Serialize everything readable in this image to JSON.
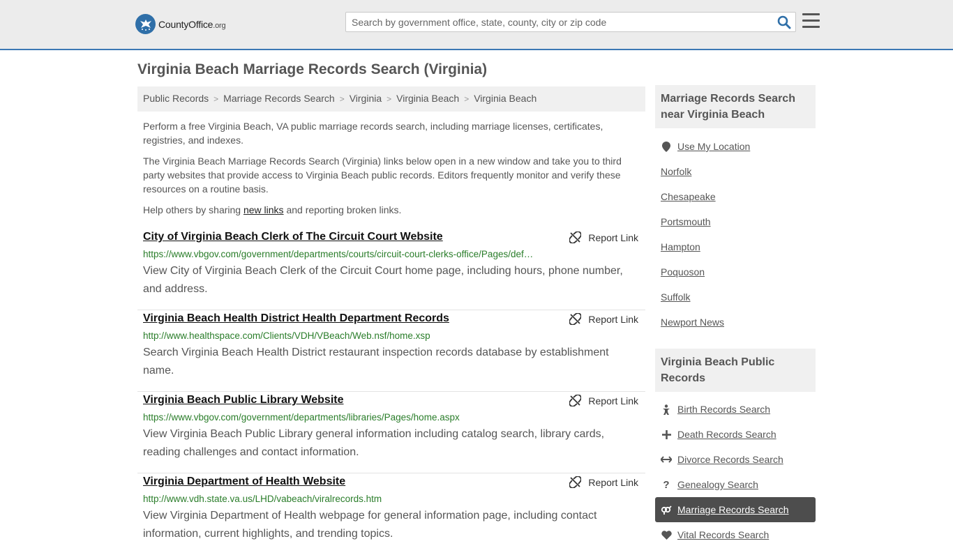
{
  "header": {
    "logo_main": "CountyOffice",
    "logo_suffix": ".org",
    "search_placeholder": "Search by government office, state, county, city or zip code"
  },
  "page_title": "Virginia Beach Marriage Records Search (Virginia)",
  "breadcrumb": [
    "Public Records",
    "Marriage Records Search",
    "Virginia",
    "Virginia Beach",
    "Virginia Beach"
  ],
  "intro": {
    "p1": "Perform a free Virginia Beach, VA public marriage records search, including marriage licenses, certificates, registries, and indexes.",
    "p2": "The Virginia Beach Marriage Records Search (Virginia) links below open in a new window and take you to third party websites that provide access to Virginia Beach public records. Editors frequently monitor and verify these resources on a routine basis.",
    "p3_before": "Help others by sharing ",
    "p3_link": "new links",
    "p3_after": " and reporting broken links."
  },
  "report_label": "Report Link",
  "results": [
    {
      "title": "City of Virginia Beach Clerk of The Circuit Court Website",
      "url": "https://www.vbgov.com/government/departments/courts/circuit-court-clerks-office/Pages/def…",
      "desc": "View City of Virginia Beach Clerk of the Circuit Court home page, including hours, phone number, and address."
    },
    {
      "title": "Virginia Beach Health District Health Department Records",
      "url": "http://www.healthspace.com/Clients/VDH/VBeach/Web.nsf/home.xsp",
      "desc": "Search Virginia Beach Health District restaurant inspection records database by establishment name."
    },
    {
      "title": "Virginia Beach Public Library Website",
      "url": "https://www.vbgov.com/government/departments/libraries/Pages/home.aspx",
      "desc": "View Virginia Beach Public Library general information including catalog search, library cards, reading challenges and contact information."
    },
    {
      "title": "Virginia Department of Health Website",
      "url": "http://www.vdh.state.va.us/LHD/vabeach/viralrecords.htm",
      "desc": "View Virginia Department of Health webpage for general information page, including contact information, current highlights, and trending topics."
    }
  ],
  "sidebar": {
    "nearby_heading": "Marriage Records Search near Virginia Beach",
    "use_location": "Use My Location",
    "nearby": [
      "Norfolk",
      "Chesapeake",
      "Portsmouth",
      "Hampton",
      "Poquoson",
      "Suffolk",
      "Newport News"
    ],
    "public_heading": "Virginia Beach Public Records",
    "public_records": [
      {
        "label": "Birth Records Search",
        "icon": "baby-icon",
        "glyph": "🯅"
      },
      {
        "label": "Death Records Search",
        "icon": "cross-icon",
        "glyph": "✚"
      },
      {
        "label": "Divorce Records Search",
        "icon": "split-arrows-icon",
        "glyph": "↔"
      },
      {
        "label": "Genealogy Search",
        "icon": "question-icon",
        "glyph": "?"
      },
      {
        "label": "Marriage Records Search",
        "icon": "venus-mars-icon",
        "glyph": "⚤"
      },
      {
        "label": "Vital Records Search",
        "icon": "heartbeat-icon",
        "glyph": "♥"
      }
    ]
  },
  "colors": {
    "accent": "#3c78b4",
    "url_green": "#2a7d2a",
    "active_bg": "#4d4d4d"
  }
}
